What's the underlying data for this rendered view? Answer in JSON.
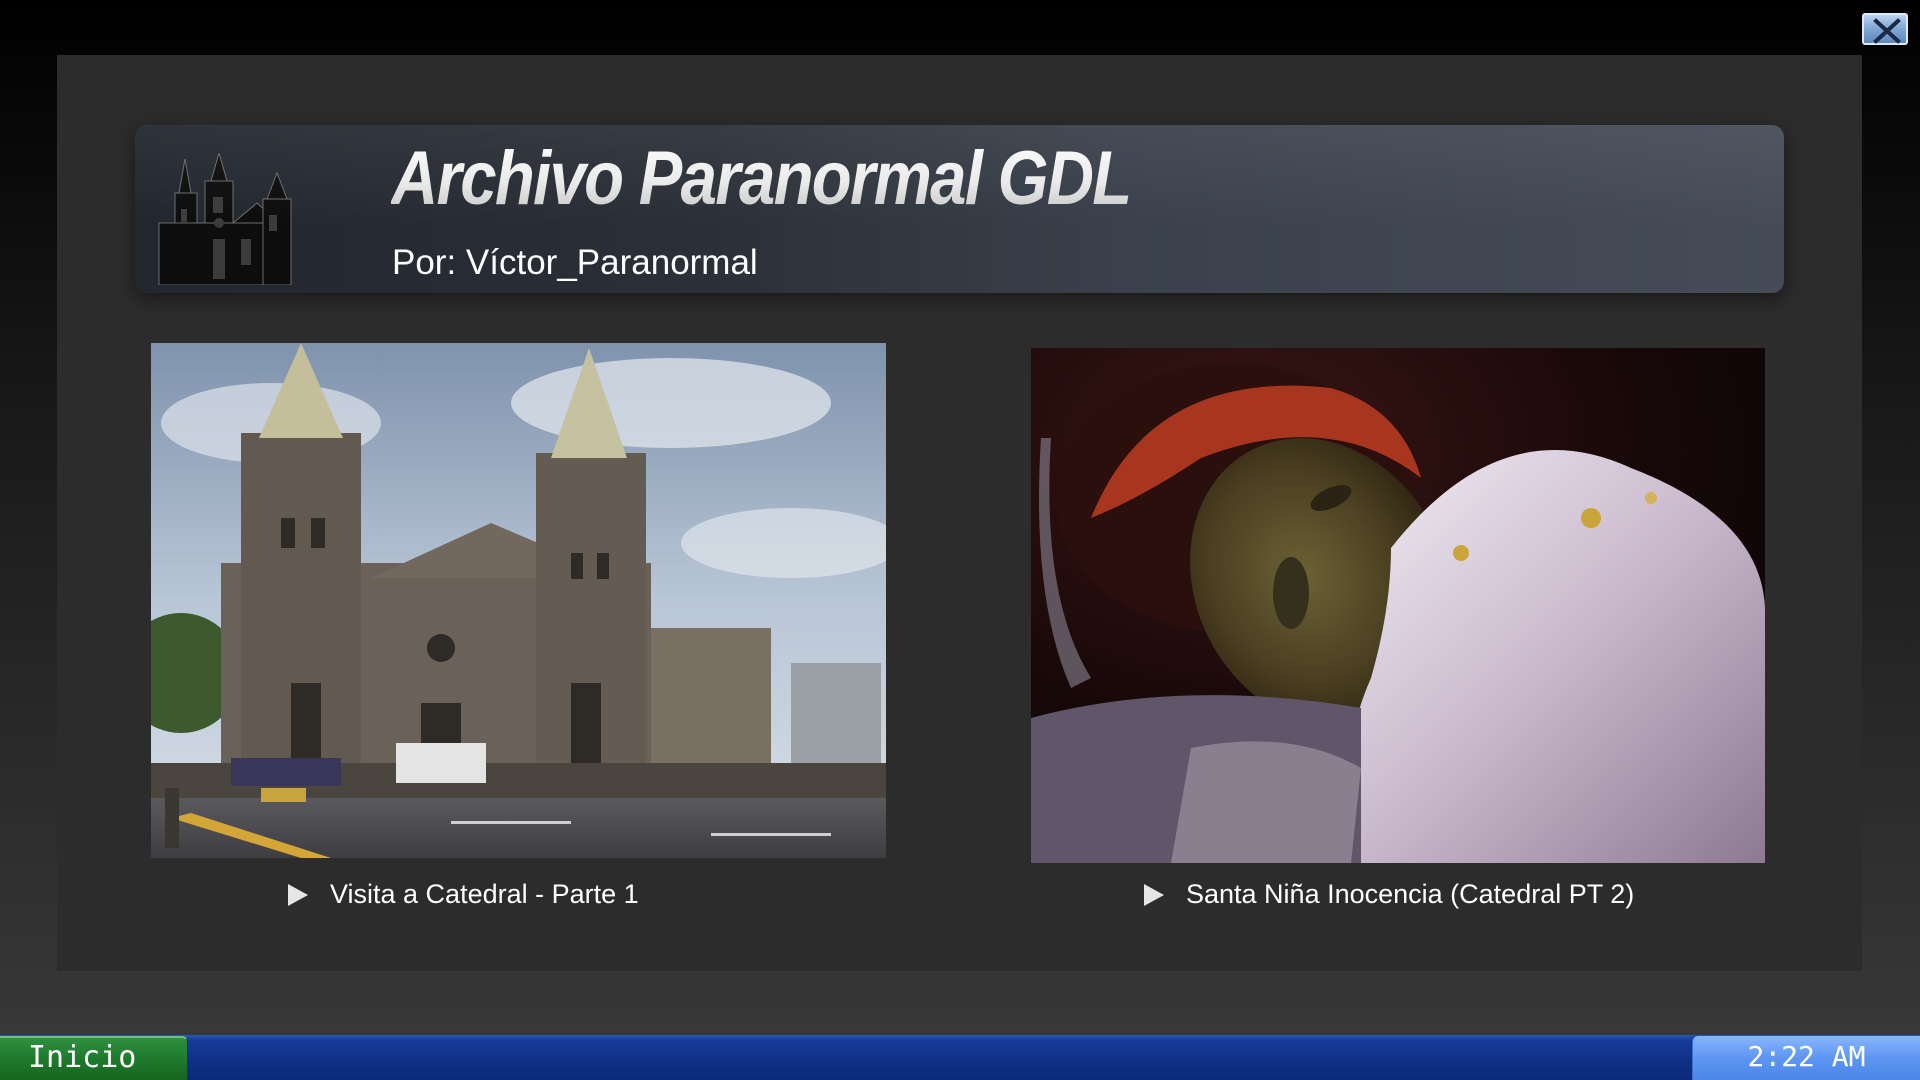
{
  "window": {
    "close_icon": "close-icon"
  },
  "header": {
    "title": "Archivo Paranormal GDL",
    "author": "Por: Víctor_Paranormal",
    "logo_icon": "cathedral-logo-icon"
  },
  "videos": [
    {
      "title": "Visita a Catedral - Parte 1",
      "thumbnail": "cathedral-photo",
      "icon": "play-icon"
    },
    {
      "title": "Santa Niña Inocencia (Catedral PT 2)",
      "thumbnail": "reclining-figure-photo",
      "icon": "play-icon"
    }
  ],
  "taskbar": {
    "start_label": "Inicio",
    "clock": "2:22 AM"
  },
  "colors": {
    "taskbar_blue": "#0f2f85",
    "start_green": "#1f7a2c",
    "clock_blue": "#5d96f2",
    "panel": "#2c2c2c"
  }
}
